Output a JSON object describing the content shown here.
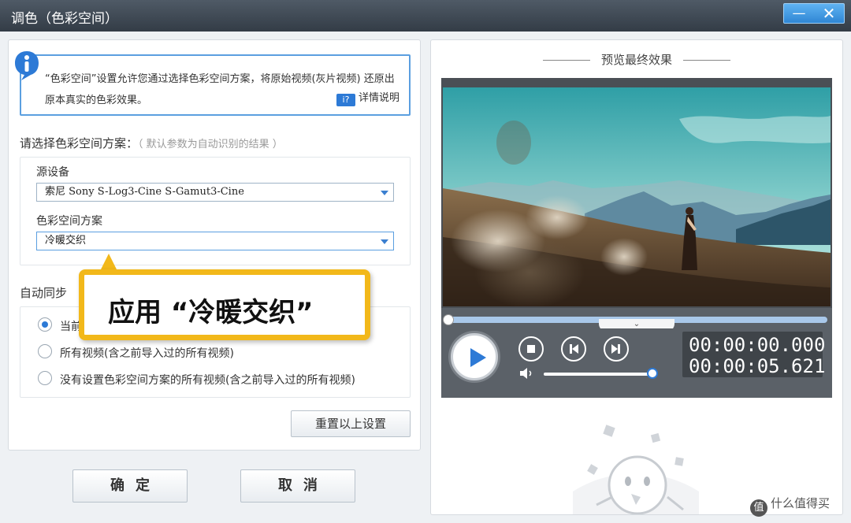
{
  "window": {
    "title": "调色（色彩空间）",
    "minimize_glyph": "—",
    "close_glyph": "✕"
  },
  "info": {
    "icon": "info-icon",
    "text": "“色彩空间”设置允许您通过选择色彩空间方案，将原始视频(灰片视频) 还原出原本真实的色彩效果。",
    "link_badge": "i?",
    "link_label": "详情说明"
  },
  "colorspace": {
    "heading": "请选择色彩空间方案：",
    "hint": "（ 默认参数为自动识别的结果 ）",
    "source_label": "源设备",
    "source_value": "索尼 Sony S-Log3-Cine S-Gamut3-Cine",
    "scheme_label": "色彩空间方案",
    "scheme_value": "冷暖交织"
  },
  "sync": {
    "heading": "自动同步",
    "options": [
      {
        "label": "当前视频",
        "selected": true
      },
      {
        "label": "所有视频(含之前导入过的所有视频)",
        "selected": false
      },
      {
        "label": "没有设置色彩空间方案的所有视频(含之前导入过的所有视频)",
        "selected": false
      }
    ],
    "reset_label": "重置以上设置"
  },
  "callout": {
    "text": "应用 “冷暖交织”",
    "color": "#f2b81a"
  },
  "footer": {
    "ok_label": "确定",
    "cancel_label": "取消"
  },
  "preview": {
    "title": "预览最终效果",
    "progress": 0.0,
    "volume": 1.0,
    "current_time": "00:00:00.000",
    "total_time": "00:00:05.621",
    "tab_glyph": "⌄"
  },
  "watermark": {
    "badge": "值",
    "text": "什么值得买"
  },
  "colors": {
    "accent": "#2d7ad6",
    "titlebar": "#3c4550",
    "control_bar": "#5b6168"
  }
}
